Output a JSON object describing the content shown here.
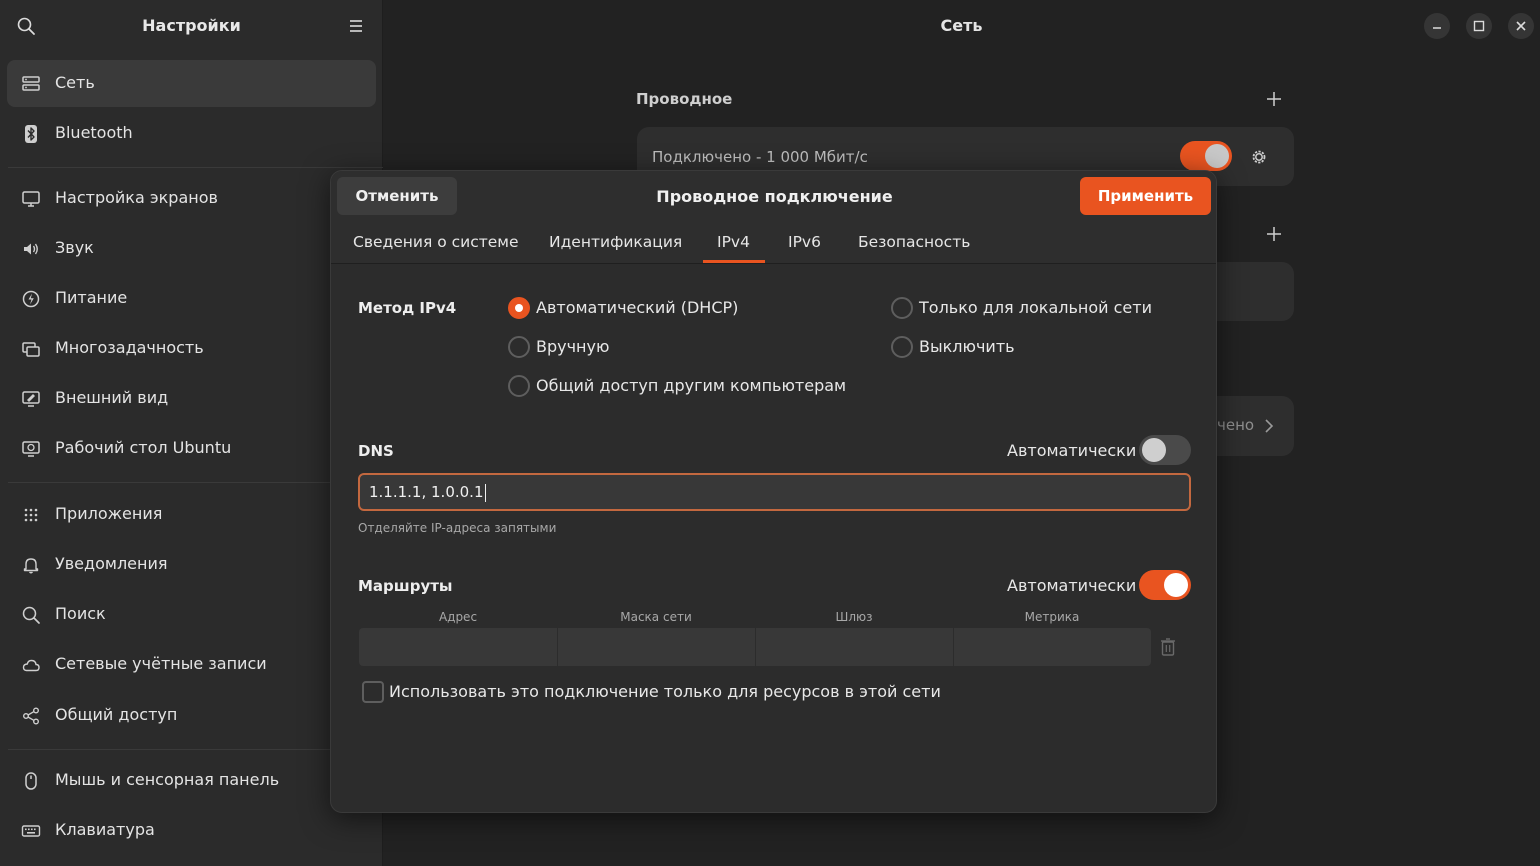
{
  "sidebar": {
    "title": "Настройки",
    "items": [
      {
        "label": "Сеть",
        "icon": "network-icon",
        "active": true
      },
      {
        "label": "Bluetooth",
        "icon": "bluetooth-icon"
      },
      {
        "label": "Настройка экранов",
        "icon": "display-icon"
      },
      {
        "label": "Звук",
        "icon": "sound-icon"
      },
      {
        "label": "Питание",
        "icon": "power-icon"
      },
      {
        "label": "Многозадачность",
        "icon": "multitasking-icon"
      },
      {
        "label": "Внешний вид",
        "icon": "appearance-icon"
      },
      {
        "label": "Рабочий стол Ubuntu",
        "icon": "ubuntu-desktop-icon"
      },
      {
        "label": "Приложения",
        "icon": "apps-grid-icon"
      },
      {
        "label": "Уведомления",
        "icon": "bell-icon"
      },
      {
        "label": "Поиск",
        "icon": "search-icon"
      },
      {
        "label": "Сетевые учётные записи",
        "icon": "cloud-icon"
      },
      {
        "label": "Общий доступ",
        "icon": "share-icon"
      },
      {
        "label": "Мышь и сенсорная панель",
        "icon": "mouse-icon"
      },
      {
        "label": "Клавиатура",
        "icon": "keyboard-icon"
      }
    ]
  },
  "main": {
    "title": "Сеть",
    "wired_section": "Проводное",
    "wired_status": "Подключено - 1 000 Мбит/с",
    "partial_text": "чено"
  },
  "dialog": {
    "cancel": "Отменить",
    "title": "Проводное подключение",
    "apply": "Применить",
    "tabs": [
      "Сведения о системе",
      "Идентификация",
      "IPv4",
      "IPv6",
      "Безопасность"
    ],
    "active_tab": "IPv4",
    "method_label": "Метод IPv4",
    "methods": {
      "dhcp": "Автоматический (DHCP)",
      "manual": "Вручную",
      "shared": "Общий доступ другим компьютерам",
      "link_local": "Только для локальной сети",
      "disabled": "Выключить"
    },
    "selected_method": "dhcp",
    "dns_label": "DNS",
    "dns_auto_label": "Автоматически",
    "dns_auto": false,
    "dns_value": "1.1.1.1, 1.0.0.1",
    "dns_hint": "Отделяйте IP-адреса запятыми",
    "routes_label": "Маршруты",
    "routes_auto_label": "Автоматически",
    "routes_auto": true,
    "route_columns": [
      "Адрес",
      "Маска сети",
      "Шлюз",
      "Метрика"
    ],
    "only_local_label": "Использовать это подключение только для ресурсов в этой сети",
    "only_local_checked": false
  },
  "colors": {
    "accent": "#e95420",
    "sidebar_bg": "#2b2b2b",
    "window_bg": "#222222",
    "dialog_bg": "#2c2c2c"
  }
}
